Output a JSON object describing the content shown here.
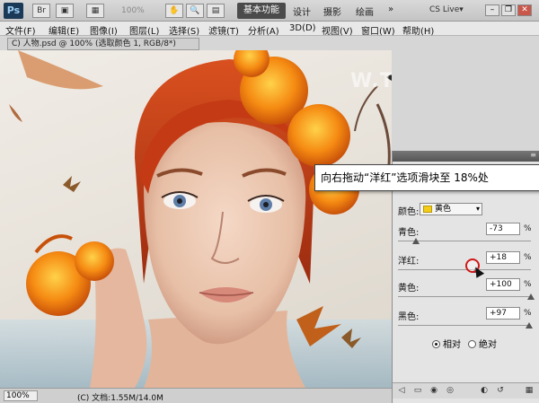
{
  "app": {
    "logo": "Ps",
    "zoom_display": "100%",
    "workspaces": [
      "基本功能",
      "设计",
      "摄影",
      "绘画"
    ],
    "cs_live": "CS Live▾",
    "more": "»"
  },
  "menu": [
    "文件(F)",
    "编辑(E)",
    "图像(I)",
    "图层(L)",
    "选择(S)",
    "滤镜(T)",
    "分析(A)",
    "3D(D)",
    "视图(V)",
    "窗口(W)",
    "帮助(H)"
  ],
  "document": {
    "tab_title": "C) 人物.psd @ 100% (选取颜色 1, RGB/8*)",
    "watermark": "W.TLMI.NET",
    "status_zoom": "100%",
    "status_info": "(C) 文档:1.55M/14.0M"
  },
  "panel": {
    "color_label": "颜色:",
    "color_value": "黄色",
    "swatch_color": "#f3cc17",
    "sliders": [
      {
        "label": "青色:",
        "value": "-73",
        "unit": "%",
        "level": -0.73
      },
      {
        "label": "洋红:",
        "value": "+18",
        "unit": "%",
        "level": 0.18
      },
      {
        "label": "黄色:",
        "value": "+100",
        "unit": "%",
        "level": 1.0
      },
      {
        "label": "黑色:",
        "value": "+97",
        "unit": "%",
        "level": 0.97
      }
    ],
    "radio_relative": "相对",
    "radio_absolute": "绝对",
    "radio_selected": "relative"
  },
  "callout": {
    "text": "向右拖动“洋红”选项滑块至 18%处"
  },
  "colors": {
    "accent_highlight": "#d01818",
    "hair": "#c2401a",
    "flower": "#f08a16"
  }
}
